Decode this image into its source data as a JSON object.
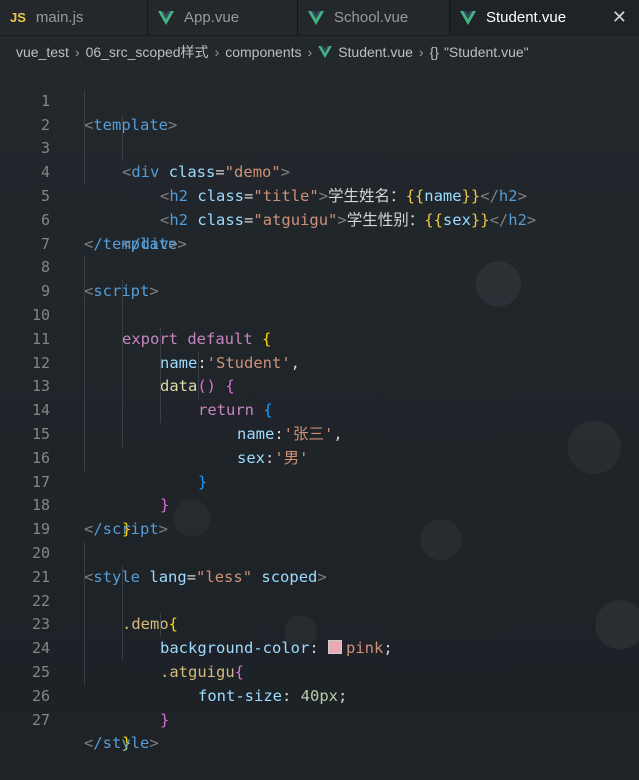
{
  "tabs": [
    {
      "badge": "JS",
      "label": "main.js"
    },
    {
      "label": "App.vue"
    },
    {
      "label": "School.vue"
    },
    {
      "label": "Student.vue",
      "close": "✕"
    }
  ],
  "breadcrumb": {
    "project": "vue_test",
    "folder": "06_src_scoped样式",
    "subfolder": "components",
    "file": "Student.vue",
    "symbol_icon": "{}",
    "symbol": "\"Student.vue\"",
    "separator": "›"
  },
  "lines": {
    "1": "1",
    "2": "2",
    "3": "3",
    "4": "4",
    "5": "5",
    "6": "6",
    "7": "7",
    "8": "8",
    "9": "9",
    "10": "10",
    "11": "11",
    "12": "12",
    "13": "13",
    "14": "14",
    "15": "15",
    "16": "16",
    "17": "17",
    "18": "18",
    "19": "19",
    "20": "20",
    "21": "21",
    "22": "22",
    "23": "23",
    "24": "24",
    "25": "25",
    "26": "26",
    "27": "27"
  },
  "code": {
    "l1": {
      "tag": "template"
    },
    "l2": {
      "tag": "div",
      "attr": "class",
      "val": "\"demo\""
    },
    "l3": {
      "tag": "h2",
      "attr": "class",
      "val": "\"title\"",
      "text": "学生姓名：",
      "var": "name"
    },
    "l4": {
      "tag": "h2",
      "attr": "class",
      "val": "\"atguigu\"",
      "text": "学生性别：",
      "var": "sex"
    },
    "l5": {
      "tag": "/div"
    },
    "l6": {
      "tag": "/template"
    },
    "l8": {
      "tag": "script"
    },
    "l9": {
      "kw1": "export",
      "kw2": "default"
    },
    "l10": {
      "key": "name",
      "val": "'Student'"
    },
    "l11": {
      "fn": "data"
    },
    "l12": {
      "kw": "return"
    },
    "l13": {
      "key": "name",
      "val": "'张三'"
    },
    "l14": {
      "key": "sex",
      "val": "'男'"
    },
    "l18": {
      "tag": "/script"
    },
    "l20": {
      "tag": "style",
      "attr1": "lang",
      "val1": "\"less\"",
      "attr2": "scoped"
    },
    "l21": {
      "sel": ".demo"
    },
    "l22": {
      "prop": "background-color",
      "val": "pink"
    },
    "l23": {
      "sel": ".atguigu"
    },
    "l24": {
      "prop": "font-size",
      "val": "40px"
    },
    "l27": {
      "tag": "/style"
    }
  },
  "colors": {
    "tag": "#569cd6",
    "attr": "#9cdcfe",
    "string": "#ce9178",
    "keyword": "#c586c0",
    "vue_green": "#41b883",
    "pink_swatch": "#e8aab5"
  }
}
